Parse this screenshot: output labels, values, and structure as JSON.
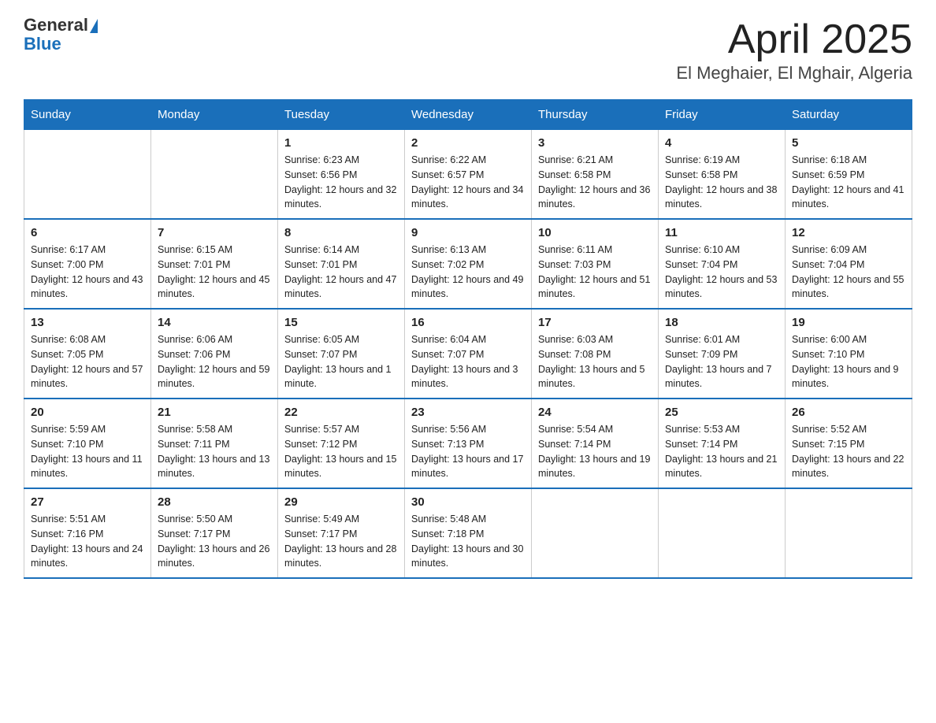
{
  "header": {
    "logo_general": "General",
    "logo_blue": "Blue",
    "title": "April 2025",
    "subtitle": "El Meghaier, El Mghair, Algeria"
  },
  "weekdays": [
    "Sunday",
    "Monday",
    "Tuesday",
    "Wednesday",
    "Thursday",
    "Friday",
    "Saturday"
  ],
  "weeks": [
    [
      {
        "day": "",
        "sunrise": "",
        "sunset": "",
        "daylight": ""
      },
      {
        "day": "",
        "sunrise": "",
        "sunset": "",
        "daylight": ""
      },
      {
        "day": "1",
        "sunrise": "Sunrise: 6:23 AM",
        "sunset": "Sunset: 6:56 PM",
        "daylight": "Daylight: 12 hours and 32 minutes."
      },
      {
        "day": "2",
        "sunrise": "Sunrise: 6:22 AM",
        "sunset": "Sunset: 6:57 PM",
        "daylight": "Daylight: 12 hours and 34 minutes."
      },
      {
        "day": "3",
        "sunrise": "Sunrise: 6:21 AM",
        "sunset": "Sunset: 6:58 PM",
        "daylight": "Daylight: 12 hours and 36 minutes."
      },
      {
        "day": "4",
        "sunrise": "Sunrise: 6:19 AM",
        "sunset": "Sunset: 6:58 PM",
        "daylight": "Daylight: 12 hours and 38 minutes."
      },
      {
        "day": "5",
        "sunrise": "Sunrise: 6:18 AM",
        "sunset": "Sunset: 6:59 PM",
        "daylight": "Daylight: 12 hours and 41 minutes."
      }
    ],
    [
      {
        "day": "6",
        "sunrise": "Sunrise: 6:17 AM",
        "sunset": "Sunset: 7:00 PM",
        "daylight": "Daylight: 12 hours and 43 minutes."
      },
      {
        "day": "7",
        "sunrise": "Sunrise: 6:15 AM",
        "sunset": "Sunset: 7:01 PM",
        "daylight": "Daylight: 12 hours and 45 minutes."
      },
      {
        "day": "8",
        "sunrise": "Sunrise: 6:14 AM",
        "sunset": "Sunset: 7:01 PM",
        "daylight": "Daylight: 12 hours and 47 minutes."
      },
      {
        "day": "9",
        "sunrise": "Sunrise: 6:13 AM",
        "sunset": "Sunset: 7:02 PM",
        "daylight": "Daylight: 12 hours and 49 minutes."
      },
      {
        "day": "10",
        "sunrise": "Sunrise: 6:11 AM",
        "sunset": "Sunset: 7:03 PM",
        "daylight": "Daylight: 12 hours and 51 minutes."
      },
      {
        "day": "11",
        "sunrise": "Sunrise: 6:10 AM",
        "sunset": "Sunset: 7:04 PM",
        "daylight": "Daylight: 12 hours and 53 minutes."
      },
      {
        "day": "12",
        "sunrise": "Sunrise: 6:09 AM",
        "sunset": "Sunset: 7:04 PM",
        "daylight": "Daylight: 12 hours and 55 minutes."
      }
    ],
    [
      {
        "day": "13",
        "sunrise": "Sunrise: 6:08 AM",
        "sunset": "Sunset: 7:05 PM",
        "daylight": "Daylight: 12 hours and 57 minutes."
      },
      {
        "day": "14",
        "sunrise": "Sunrise: 6:06 AM",
        "sunset": "Sunset: 7:06 PM",
        "daylight": "Daylight: 12 hours and 59 minutes."
      },
      {
        "day": "15",
        "sunrise": "Sunrise: 6:05 AM",
        "sunset": "Sunset: 7:07 PM",
        "daylight": "Daylight: 13 hours and 1 minute."
      },
      {
        "day": "16",
        "sunrise": "Sunrise: 6:04 AM",
        "sunset": "Sunset: 7:07 PM",
        "daylight": "Daylight: 13 hours and 3 minutes."
      },
      {
        "day": "17",
        "sunrise": "Sunrise: 6:03 AM",
        "sunset": "Sunset: 7:08 PM",
        "daylight": "Daylight: 13 hours and 5 minutes."
      },
      {
        "day": "18",
        "sunrise": "Sunrise: 6:01 AM",
        "sunset": "Sunset: 7:09 PM",
        "daylight": "Daylight: 13 hours and 7 minutes."
      },
      {
        "day": "19",
        "sunrise": "Sunrise: 6:00 AM",
        "sunset": "Sunset: 7:10 PM",
        "daylight": "Daylight: 13 hours and 9 minutes."
      }
    ],
    [
      {
        "day": "20",
        "sunrise": "Sunrise: 5:59 AM",
        "sunset": "Sunset: 7:10 PM",
        "daylight": "Daylight: 13 hours and 11 minutes."
      },
      {
        "day": "21",
        "sunrise": "Sunrise: 5:58 AM",
        "sunset": "Sunset: 7:11 PM",
        "daylight": "Daylight: 13 hours and 13 minutes."
      },
      {
        "day": "22",
        "sunrise": "Sunrise: 5:57 AM",
        "sunset": "Sunset: 7:12 PM",
        "daylight": "Daylight: 13 hours and 15 minutes."
      },
      {
        "day": "23",
        "sunrise": "Sunrise: 5:56 AM",
        "sunset": "Sunset: 7:13 PM",
        "daylight": "Daylight: 13 hours and 17 minutes."
      },
      {
        "day": "24",
        "sunrise": "Sunrise: 5:54 AM",
        "sunset": "Sunset: 7:14 PM",
        "daylight": "Daylight: 13 hours and 19 minutes."
      },
      {
        "day": "25",
        "sunrise": "Sunrise: 5:53 AM",
        "sunset": "Sunset: 7:14 PM",
        "daylight": "Daylight: 13 hours and 21 minutes."
      },
      {
        "day": "26",
        "sunrise": "Sunrise: 5:52 AM",
        "sunset": "Sunset: 7:15 PM",
        "daylight": "Daylight: 13 hours and 22 minutes."
      }
    ],
    [
      {
        "day": "27",
        "sunrise": "Sunrise: 5:51 AM",
        "sunset": "Sunset: 7:16 PM",
        "daylight": "Daylight: 13 hours and 24 minutes."
      },
      {
        "day": "28",
        "sunrise": "Sunrise: 5:50 AM",
        "sunset": "Sunset: 7:17 PM",
        "daylight": "Daylight: 13 hours and 26 minutes."
      },
      {
        "day": "29",
        "sunrise": "Sunrise: 5:49 AM",
        "sunset": "Sunset: 7:17 PM",
        "daylight": "Daylight: 13 hours and 28 minutes."
      },
      {
        "day": "30",
        "sunrise": "Sunrise: 5:48 AM",
        "sunset": "Sunset: 7:18 PM",
        "daylight": "Daylight: 13 hours and 30 minutes."
      },
      {
        "day": "",
        "sunrise": "",
        "sunset": "",
        "daylight": ""
      },
      {
        "day": "",
        "sunrise": "",
        "sunset": "",
        "daylight": ""
      },
      {
        "day": "",
        "sunrise": "",
        "sunset": "",
        "daylight": ""
      }
    ]
  ]
}
